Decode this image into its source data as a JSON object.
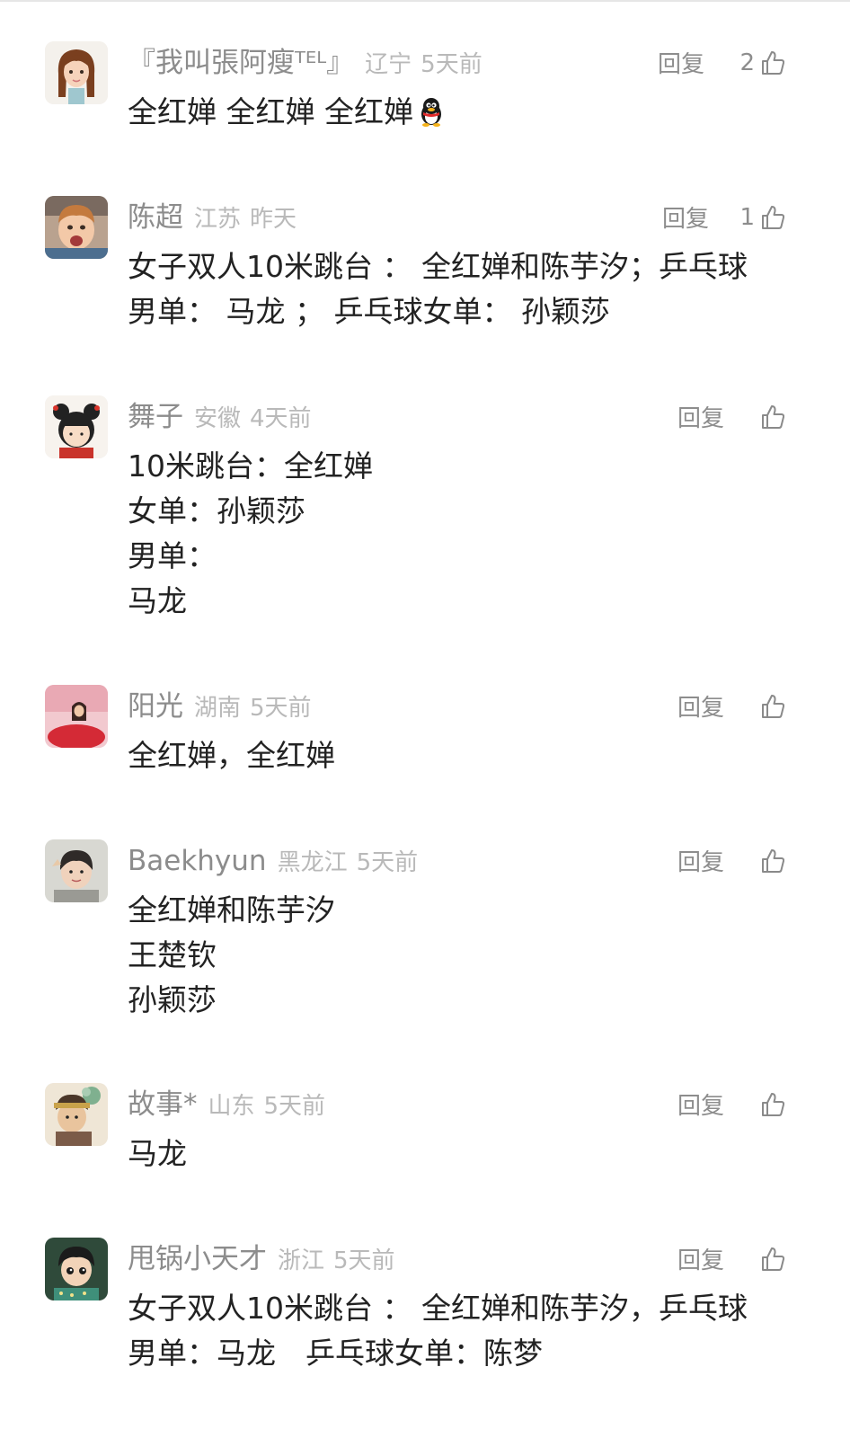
{
  "comments": [
    {
      "username": "『我叫張阿瘦ᵀᴱᴸ』",
      "location": "辽宁",
      "time": "5天前",
      "reply_label": "回复",
      "likes": "2",
      "lines": [
        "全红婵 全红婵 全红婵"
      ],
      "emoji": "qq-penguin-icon"
    },
    {
      "username": "陈超",
      "location": "江苏",
      "time": "昨天",
      "reply_label": "回复",
      "likes": "1",
      "lines": [
        "女子双人10米跳台 ： 全红婵和陈芋汐；乒乓球",
        "男单： 马龙 ； 乒乓球女单： 孙颖莎"
      ]
    },
    {
      "username": "舞子",
      "location": "安徽",
      "time": "4天前",
      "reply_label": "回复",
      "likes": "",
      "lines": [
        "10米跳台：全红婵",
        "女单：孙颖莎",
        "男单：",
        "马龙"
      ]
    },
    {
      "username": "阳光",
      "location": "湖南",
      "time": "5天前",
      "reply_label": "回复",
      "likes": "",
      "lines": [
        "全红婵，全红婵"
      ]
    },
    {
      "username": "Baekhyun",
      "location": "黑龙江",
      "time": "5天前",
      "reply_label": "回复",
      "likes": "",
      "lines": [
        "全红婵和陈芋汐",
        "王楚钦",
        "孙颖莎"
      ]
    },
    {
      "username": "故事*",
      "location": "山东",
      "time": "5天前",
      "reply_label": "回复",
      "likes": "",
      "lines": [
        "马龙"
      ]
    },
    {
      "username": "甩锅小天才",
      "location": "浙江",
      "time": "5天前",
      "reply_label": "回复",
      "likes": "",
      "lines": [
        "女子双人10米跳台 ： 全红婵和陈芋汐，乒乓球",
        "男单：马龙　乒乓球女单：陈梦"
      ]
    }
  ],
  "icons": {
    "like": "thumbs-up-icon",
    "avatar": "avatar-image"
  },
  "colors": {
    "username": "#8c8c8c",
    "meta": "#b9b9b9",
    "text": "#222222",
    "action": "#8d8d8d"
  }
}
